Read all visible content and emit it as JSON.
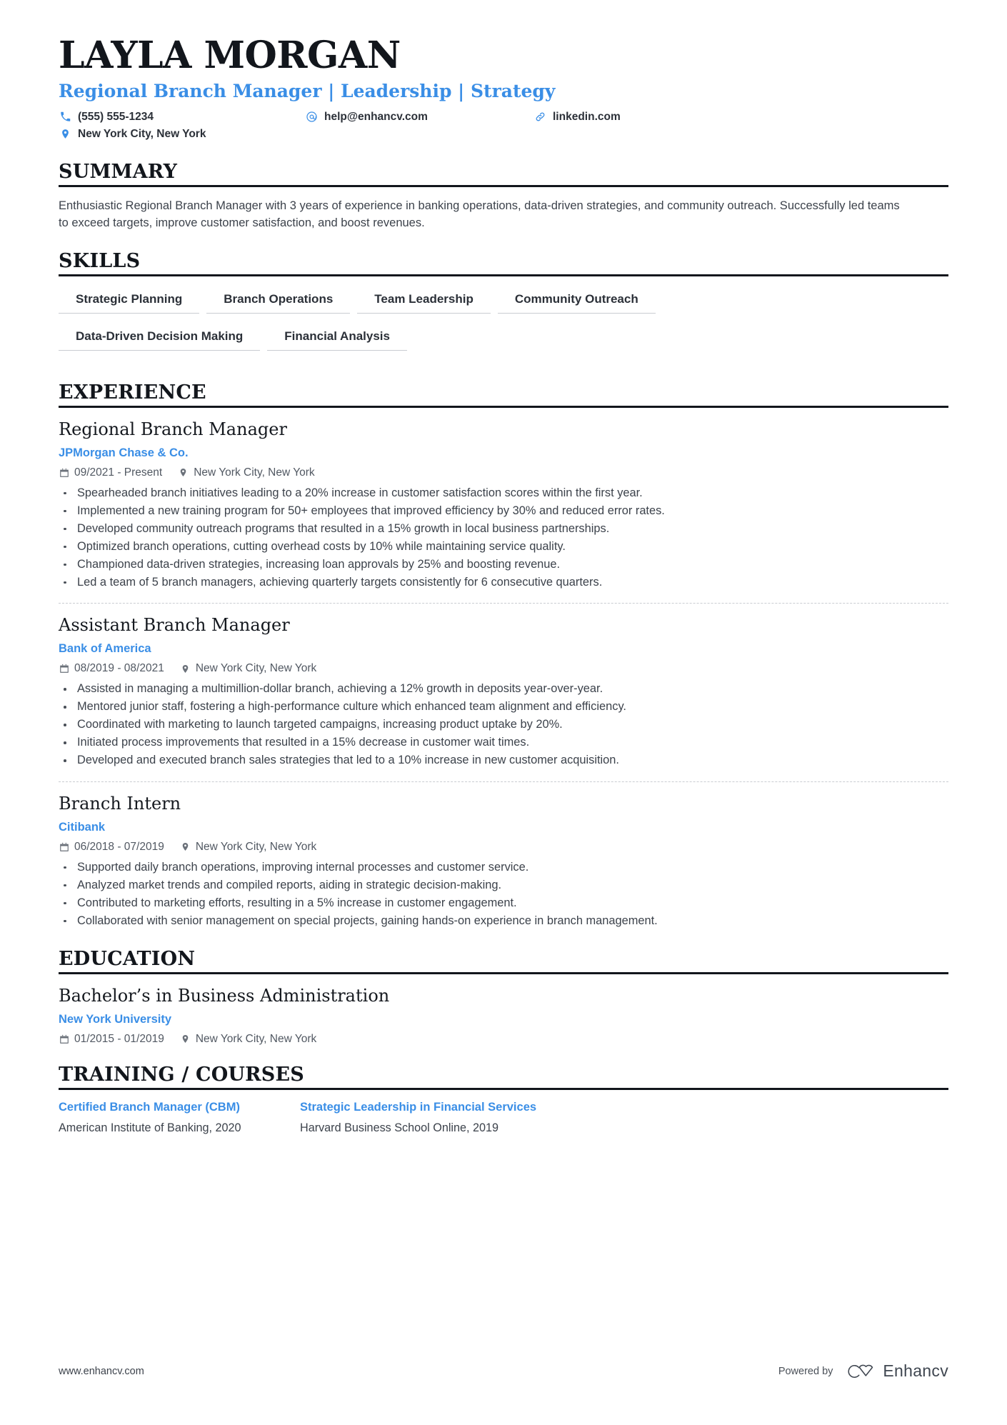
{
  "header": {
    "name": "LAYLA MORGAN",
    "headline": "Regional Branch Manager | Leadership | Strategy",
    "contacts": [
      {
        "icon": "phone-icon",
        "value": "(555) 555-1234"
      },
      {
        "icon": "email-icon",
        "value": "help@enhancv.com"
      },
      {
        "icon": "link-icon",
        "value": "linkedin.com"
      },
      {
        "icon": "location-icon",
        "value": "New York City, New York"
      }
    ]
  },
  "summary": {
    "title": "SUMMARY",
    "text": "Enthusiastic Regional Branch Manager with 3 years of experience in banking operations, data-driven strategies, and community outreach. Successfully led teams to exceed targets, improve customer satisfaction, and boost revenues."
  },
  "skills": {
    "title": "SKILLS",
    "items": [
      "Strategic Planning",
      "Branch Operations",
      "Team Leadership",
      "Community Outreach",
      "Data-Driven Decision Making",
      "Financial Analysis"
    ]
  },
  "experience": {
    "title": "EXPERIENCE",
    "entries": [
      {
        "role": "Regional Branch Manager",
        "company": "JPMorgan Chase & Co.",
        "dates": "09/2021 - Present",
        "location": "New York City, New York",
        "bullets": [
          "Spearheaded branch initiatives leading to a 20% increase in customer satisfaction scores within the first year.",
          "Implemented a new training program for 50+ employees that improved efficiency by 30% and reduced error rates.",
          "Developed community outreach programs that resulted in a 15% growth in local business partnerships.",
          "Optimized branch operations, cutting overhead costs by 10% while maintaining service quality.",
          "Championed data-driven strategies, increasing loan approvals by 25% and boosting revenue.",
          "Led a team of 5 branch managers, achieving quarterly targets consistently for 6 consecutive quarters."
        ]
      },
      {
        "role": "Assistant Branch Manager",
        "company": "Bank of America",
        "dates": "08/2019 - 08/2021",
        "location": "New York City, New York",
        "bullets": [
          "Assisted in managing a multimillion-dollar branch, achieving a 12% growth in deposits year-over-year.",
          "Mentored junior staff, fostering a high-performance culture which enhanced team alignment and efficiency.",
          "Coordinated with marketing to launch targeted campaigns, increasing product uptake by 20%.",
          "Initiated process improvements that resulted in a 15% decrease in customer wait times.",
          "Developed and executed branch sales strategies that led to a 10% increase in new customer acquisition."
        ]
      },
      {
        "role": "Branch Intern",
        "company": "Citibank",
        "dates": "06/2018 - 07/2019",
        "location": "New York City, New York",
        "bullets": [
          "Supported daily branch operations, improving internal processes and customer service.",
          "Analyzed market trends and compiled reports, aiding in strategic decision-making.",
          "Contributed to marketing efforts, resulting in a 5% increase in customer engagement.",
          "Collaborated with senior management on special projects, gaining hands-on experience in branch management."
        ]
      }
    ]
  },
  "education": {
    "title": "EDUCATION",
    "entries": [
      {
        "degree": "Bachelor’s in Business Administration",
        "school": "New York University",
        "dates": "01/2015 - 01/2019",
        "location": "New York City, New York"
      }
    ]
  },
  "training": {
    "title": "TRAINING / COURSES",
    "courses": [
      {
        "name": "Certified Branch Manager (CBM)",
        "provider": "American Institute of Banking, 2020"
      },
      {
        "name": "Strategic Leadership in Financial Services",
        "provider": "Harvard Business School Online, 2019"
      }
    ]
  },
  "footer": {
    "url": "www.enhancv.com",
    "powered_by": "Powered by",
    "brand": "Enhancv"
  },
  "colors": {
    "accent": "#3a8ee6",
    "ink": "#12161c",
    "body": "#3c424b",
    "muted": "#6b717a"
  }
}
